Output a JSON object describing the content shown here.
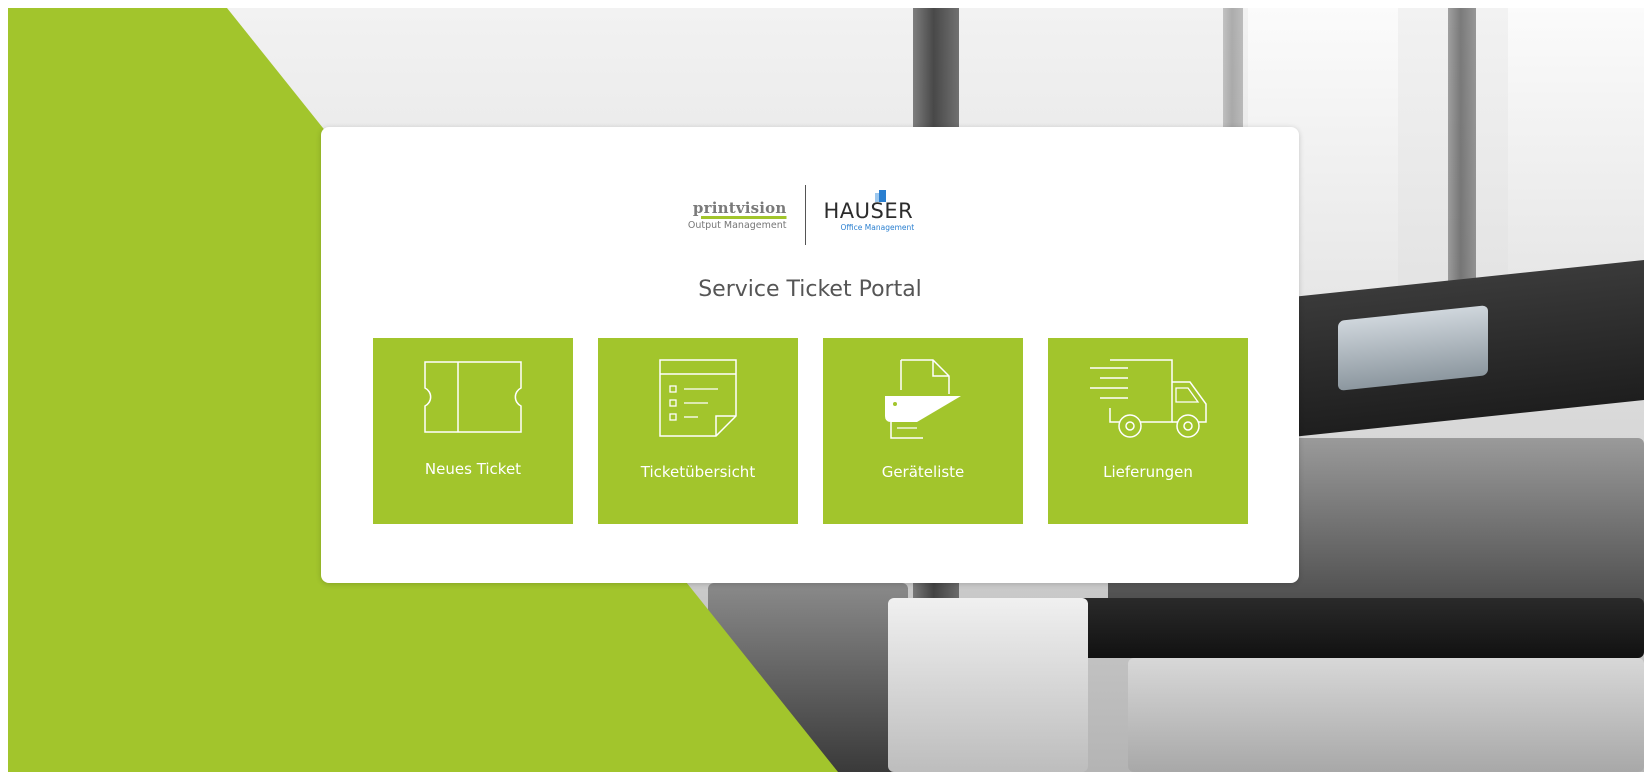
{
  "logos": {
    "printvision_brand": "printvision",
    "printvision_sub": "Output Management",
    "hauser_brand": "HAUSER",
    "hauser_sub": "Office Management"
  },
  "page": {
    "title": "Service Ticket Portal"
  },
  "tiles": [
    {
      "label": "Neues Ticket",
      "icon": "ticket-icon"
    },
    {
      "label": "Ticketübersicht",
      "icon": "checklist-icon"
    },
    {
      "label": "Geräteliste",
      "icon": "printer-icon"
    },
    {
      "label": "Lieferungen",
      "icon": "delivery-truck-icon"
    }
  ],
  "colors": {
    "accent_green": "#a2c52c",
    "card_bg": "#ffffff",
    "title_text": "#555555",
    "hauser_blue": "#2a7fd0"
  }
}
